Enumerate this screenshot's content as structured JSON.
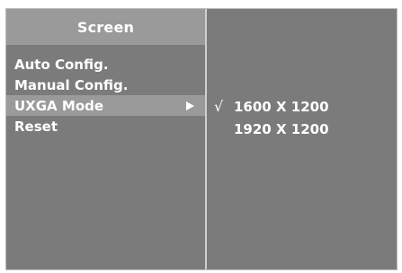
{
  "left_panel": {
    "title": "Screen",
    "items": [
      {
        "label": "Auto Config."
      },
      {
        "label": "Manual Config."
      },
      {
        "label": "UXGA Mode",
        "has_submenu": true,
        "selected": true
      },
      {
        "label": "Reset"
      }
    ]
  },
  "right_panel": {
    "options": [
      {
        "label": "1600 X 1200",
        "check": "√"
      },
      {
        "label": "1920 X 1200",
        "check": ""
      }
    ]
  },
  "colors": {
    "panel_bg": "#7b7b7b",
    "highlight_bg": "#9a9a9a",
    "text": "#ffffff"
  }
}
